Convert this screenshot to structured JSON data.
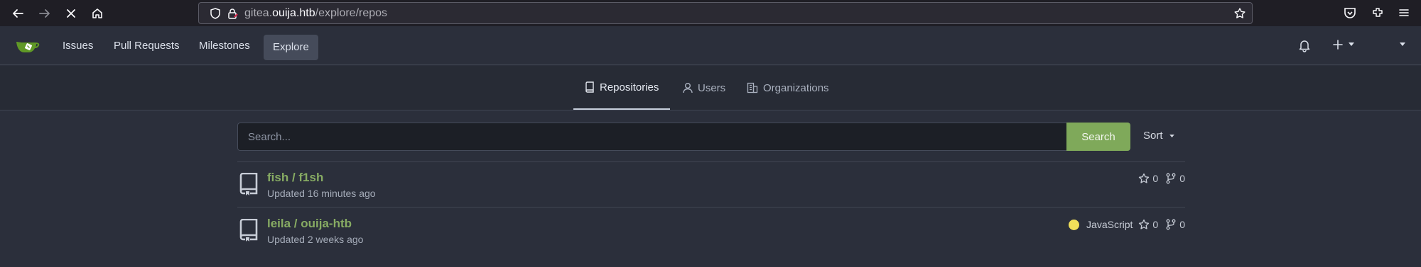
{
  "browser": {
    "url_prefix": "gitea.",
    "url_domain": "ouija.htb",
    "url_path": "/explore/repos"
  },
  "navbar": {
    "issues": "Issues",
    "pull_requests": "Pull Requests",
    "milestones": "Milestones",
    "explore": "Explore"
  },
  "subnav": {
    "repositories": "Repositories",
    "users": "Users",
    "organizations": "Organizations"
  },
  "search": {
    "placeholder": "Search...",
    "button": "Search",
    "sort": "Sort"
  },
  "repos": [
    {
      "name": "fish / f1sh",
      "updated": "Updated 16 minutes ago",
      "language": "",
      "stars": "0",
      "forks": "0"
    },
    {
      "name": "leila / ouija-htb",
      "updated": "Updated 2 weeks ago",
      "language": "JavaScript",
      "language_color": "#f1e05a",
      "stars": "0",
      "forks": "0"
    }
  ],
  "colors": {
    "accent_green": "#87ab63",
    "search_button": "#7fa95a"
  }
}
